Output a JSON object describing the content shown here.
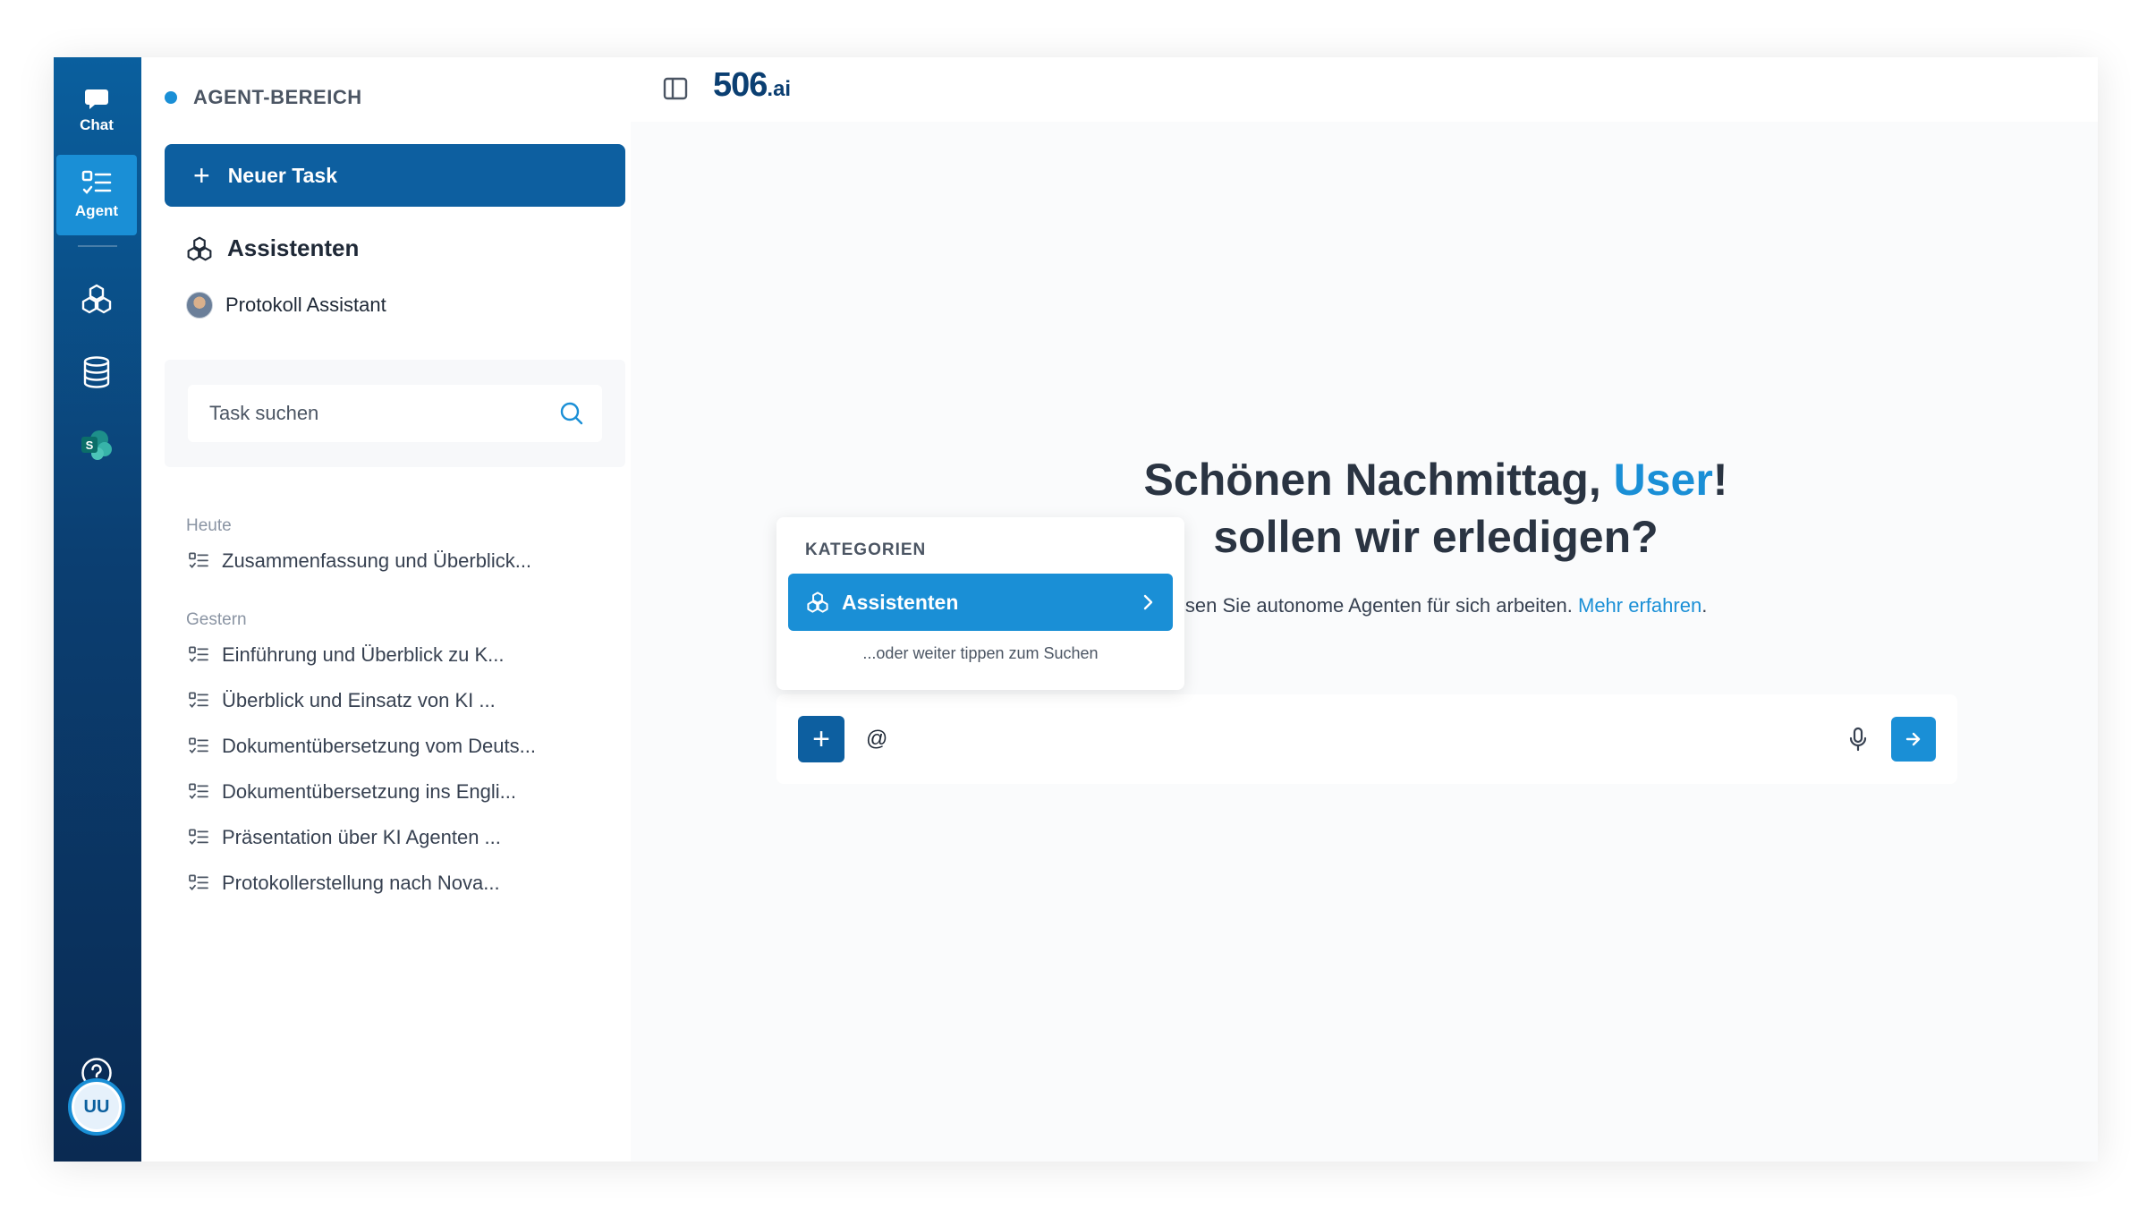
{
  "rail": {
    "chat_label": "Chat",
    "agent_label": "Agent",
    "avatar_initials": "UU",
    "accent_color": "#1a8fd6"
  },
  "sidebar": {
    "area_title": "AGENT-BEREICH",
    "new_task_label": "Neuer Task",
    "assistants_heading": "Assistenten",
    "assistants": [
      {
        "label": "Protokoll Assistant"
      }
    ],
    "search_placeholder": "Task suchen",
    "groups": [
      {
        "label": "Heute",
        "tasks": [
          "Zusammenfassung und Überblick..."
        ]
      },
      {
        "label": "Gestern",
        "tasks": [
          "Einführung und Überblick zu K...",
          "Überblick und Einsatz von KI ...",
          "Dokumentübersetzung vom Deuts...",
          "Dokumentübersetzung ins Engli...",
          "Präsentation über KI Agenten ...",
          "Protokollerstellung nach Nova..."
        ]
      }
    ]
  },
  "header": {
    "logo_main": "506",
    "logo_suffix": ".ai"
  },
  "main": {
    "greeting_prefix": "Schönen Nachmittag, ",
    "greeting_user": "User",
    "greeting_suffix": "!",
    "greeting_line2": "sollen wir erledigen?",
    "subline_text": "assen Sie autonome Agenten für sich arbeiten. ",
    "subline_link": "Mehr erfahren",
    "subline_end": ".",
    "input_value": "@"
  },
  "popover": {
    "heading": "KATEGORIEN",
    "option_label": "Assistenten",
    "hint": "...oder weiter tippen zum Suchen"
  }
}
